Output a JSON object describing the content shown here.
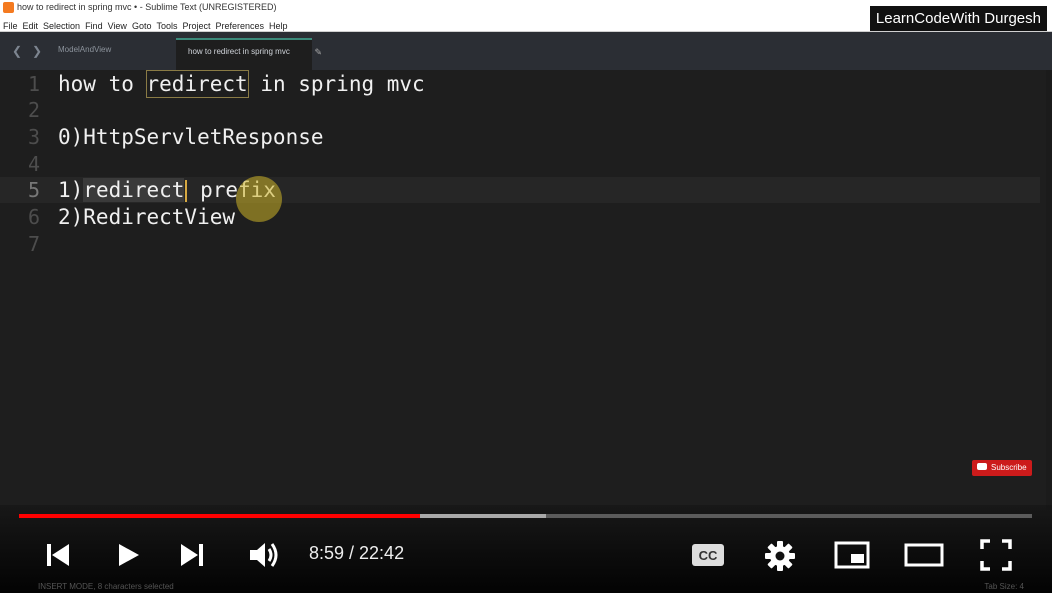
{
  "window": {
    "title": "how to redirect in spring mvc • - Sublime Text (UNREGISTERED)"
  },
  "menu": [
    "File",
    "Edit",
    "Selection",
    "Find",
    "View",
    "Goto",
    "Tools",
    "Project",
    "Preferences",
    "Help"
  ],
  "brand": "LearnCodeWith Durgesh",
  "tabs": [
    {
      "label": "ModelAndView",
      "active": false
    },
    {
      "label": "how to redirect in spring mvc",
      "active": true
    }
  ],
  "editor": {
    "lines": [
      {
        "num": "1",
        "text": "how to redirect in spring mvc"
      },
      {
        "num": "2",
        "text": ""
      },
      {
        "num": "3",
        "text": "0)HttpServletResponse"
      },
      {
        "num": "4",
        "text": ""
      },
      {
        "num": "5",
        "text": "1)redirect prefix"
      },
      {
        "num": "6",
        "text": "2)RedirectView"
      },
      {
        "num": "7",
        "text": ""
      }
    ],
    "line1_parts": [
      "how to ",
      "redirect",
      " in spring mvc"
    ],
    "line5_parts": [
      "1)",
      "redirect",
      " prefix"
    ]
  },
  "subscribe": "Subscribe",
  "player": {
    "time": "8:59 / 22:42",
    "played_fraction": 0.396,
    "loaded_fraction": 0.52
  },
  "status": {
    "left": "INSERT MODE, 8 characters selected",
    "right": "Tab Size: 4"
  }
}
